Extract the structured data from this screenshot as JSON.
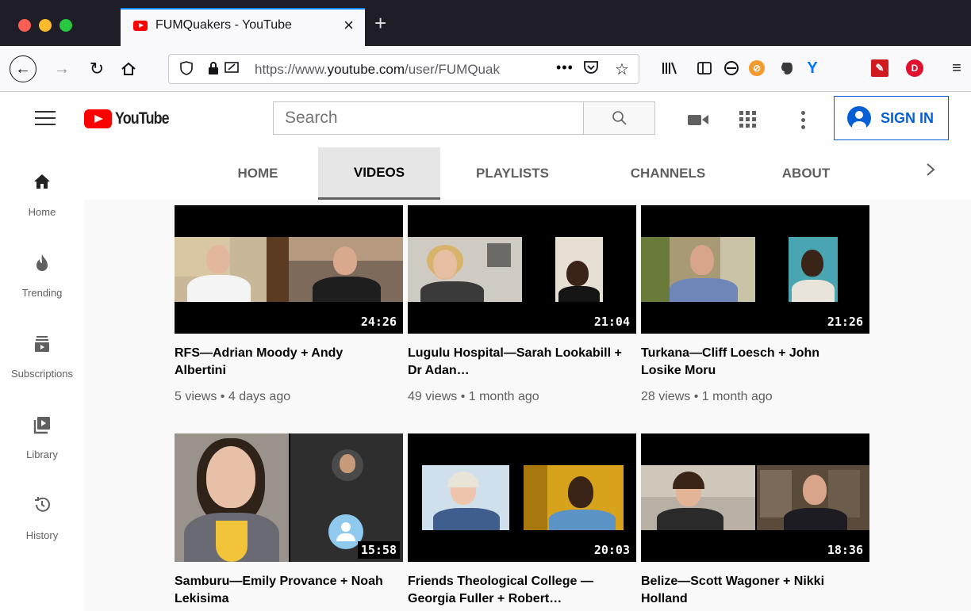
{
  "browser": {
    "tab_title": "FUMQuakers - YouTube",
    "url_prefix": "https://www.",
    "url_domain": "youtube.com",
    "url_path": "/user/FUMQuak",
    "new_tab_glyph": "+",
    "tab_close_glyph": "×",
    "accent_color": "#0a84ff"
  },
  "youtube": {
    "logo_text": "YouTube",
    "search_placeholder": "Search",
    "sign_in_label": "SIGN IN",
    "brand_color": "#ff0000",
    "link_color": "#065fd4"
  },
  "sidebar": {
    "items": [
      {
        "label": "Home",
        "icon": "home-icon"
      },
      {
        "label": "Trending",
        "icon": "trending-icon"
      },
      {
        "label": "Subscriptions",
        "icon": "subscriptions-icon"
      },
      {
        "label": "Library",
        "icon": "library-icon"
      },
      {
        "label": "History",
        "icon": "history-icon"
      }
    ]
  },
  "channel_tabs": {
    "items": [
      {
        "label": "HOME"
      },
      {
        "label": "VIDEOS",
        "active": true
      },
      {
        "label": "PLAYLISTS"
      },
      {
        "label": "CHANNELS"
      },
      {
        "label": "ABOUT"
      }
    ]
  },
  "videos": [
    {
      "title": "RFS—Adrian Moody + Andy Albertini",
      "meta": "5 views • 4 days ago",
      "duration": "24:26"
    },
    {
      "title": "Lugulu Hospital—Sarah Lookabill + Dr Adan…",
      "meta": "49 views • 1 month ago",
      "duration": "21:04"
    },
    {
      "title": "Turkana—Cliff Loesch + John Losike Moru",
      "meta": "28 views • 1 month ago",
      "duration": "21:26"
    },
    {
      "title": "Samburu—Emily Provance + Noah Lekisima",
      "meta": "",
      "duration": "15:58"
    },
    {
      "title": "Friends Theological College —Georgia Fuller + Robert…",
      "meta": "",
      "duration": "20:03"
    },
    {
      "title": "Belize—Scott Wagoner + Nikki Holland",
      "meta": "",
      "duration": "18:36"
    }
  ]
}
